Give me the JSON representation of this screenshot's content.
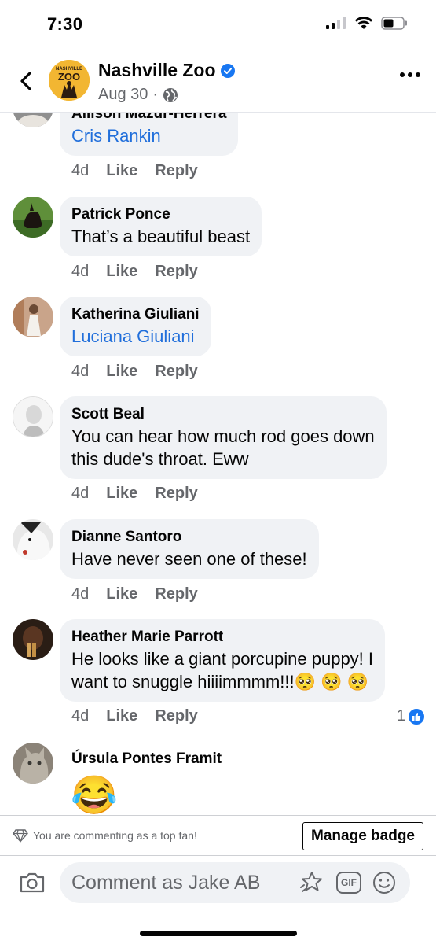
{
  "status_bar": {
    "time": "7:30"
  },
  "header": {
    "page_name": "Nashville Zoo",
    "logo_top": "NASHVILLE",
    "logo_main": "ZOO",
    "post_date": "Aug 30",
    "separator": "·"
  },
  "comments": [
    {
      "author": "Allison Mazur-Herrera",
      "text": "Cris Rankin",
      "is_mention": true,
      "age": "4d",
      "like": "Like",
      "reply": "Reply"
    },
    {
      "author": "Patrick Ponce",
      "text": "That’s a beautiful beast",
      "is_mention": false,
      "age": "4d",
      "like": "Like",
      "reply": "Reply"
    },
    {
      "author": "Katherina Giuliani",
      "text": "Luciana Giuliani",
      "is_mention": true,
      "age": "4d",
      "like": "Like",
      "reply": "Reply"
    },
    {
      "author": "Scott Beal",
      "text_lines": [
        "You can hear how much rod goes down",
        "this dude's throat. Eww"
      ],
      "is_mention": false,
      "age": "4d",
      "like": "Like",
      "reply": "Reply"
    },
    {
      "author": "Dianne Santoro",
      "text": "Have never seen one of these!",
      "is_mention": false,
      "age": "4d",
      "like": "Like",
      "reply": "Reply"
    },
    {
      "author": "Heather Marie Parrott",
      "text_lines": [
        "He looks like a giant porcupine puppy! I",
        "want to snuggle hiiiimmmm!!!"
      ],
      "is_mention": false,
      "age": "4d",
      "like": "Like",
      "reply": "Reply",
      "reaction_count": "1"
    },
    {
      "author": "Úrsula Pontes Framit",
      "emoji": "😂"
    }
  ],
  "top_fan": {
    "message": "You are commenting as a top fan!",
    "button": "Manage badge"
  },
  "composer": {
    "placeholder": "Comment as Jake AB",
    "gif_label": "GIF"
  },
  "colors": {
    "link": "#216fdb",
    "bubble": "#f0f2f5",
    "secondary_text": "#65676b",
    "verified": "#1877f2"
  }
}
